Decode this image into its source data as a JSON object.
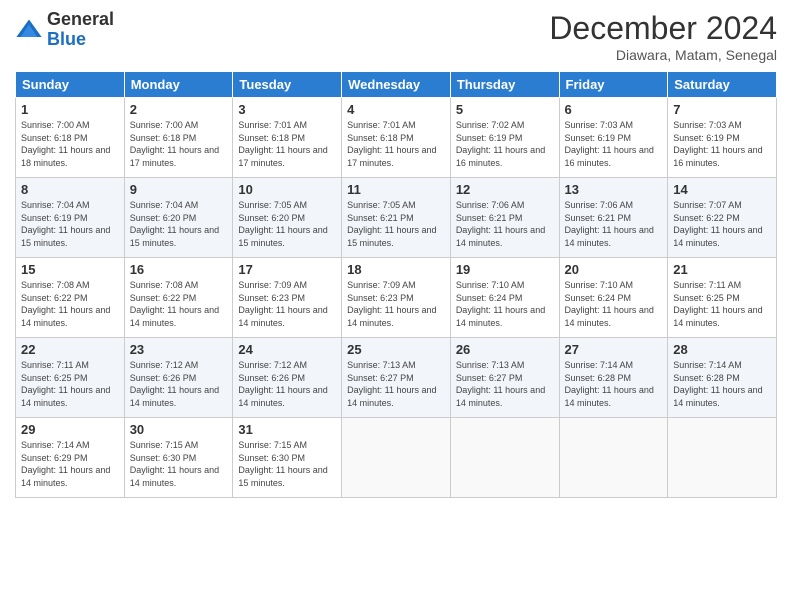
{
  "logo": {
    "general": "General",
    "blue": "Blue"
  },
  "title": "December 2024",
  "subtitle": "Diawara, Matam, Senegal",
  "days_of_week": [
    "Sunday",
    "Monday",
    "Tuesday",
    "Wednesday",
    "Thursday",
    "Friday",
    "Saturday"
  ],
  "weeks": [
    [
      {
        "day": "1",
        "sunrise": "7:00 AM",
        "sunset": "6:18 PM",
        "daylight": "11 hours and 18 minutes."
      },
      {
        "day": "2",
        "sunrise": "7:00 AM",
        "sunset": "6:18 PM",
        "daylight": "11 hours and 17 minutes."
      },
      {
        "day": "3",
        "sunrise": "7:01 AM",
        "sunset": "6:18 PM",
        "daylight": "11 hours and 17 minutes."
      },
      {
        "day": "4",
        "sunrise": "7:01 AM",
        "sunset": "6:18 PM",
        "daylight": "11 hours and 17 minutes."
      },
      {
        "day": "5",
        "sunrise": "7:02 AM",
        "sunset": "6:19 PM",
        "daylight": "11 hours and 16 minutes."
      },
      {
        "day": "6",
        "sunrise": "7:03 AM",
        "sunset": "6:19 PM",
        "daylight": "11 hours and 16 minutes."
      },
      {
        "day": "7",
        "sunrise": "7:03 AM",
        "sunset": "6:19 PM",
        "daylight": "11 hours and 16 minutes."
      }
    ],
    [
      {
        "day": "8",
        "sunrise": "7:04 AM",
        "sunset": "6:19 PM",
        "daylight": "11 hours and 15 minutes."
      },
      {
        "day": "9",
        "sunrise": "7:04 AM",
        "sunset": "6:20 PM",
        "daylight": "11 hours and 15 minutes."
      },
      {
        "day": "10",
        "sunrise": "7:05 AM",
        "sunset": "6:20 PM",
        "daylight": "11 hours and 15 minutes."
      },
      {
        "day": "11",
        "sunrise": "7:05 AM",
        "sunset": "6:21 PM",
        "daylight": "11 hours and 15 minutes."
      },
      {
        "day": "12",
        "sunrise": "7:06 AM",
        "sunset": "6:21 PM",
        "daylight": "11 hours and 14 minutes."
      },
      {
        "day": "13",
        "sunrise": "7:06 AM",
        "sunset": "6:21 PM",
        "daylight": "11 hours and 14 minutes."
      },
      {
        "day": "14",
        "sunrise": "7:07 AM",
        "sunset": "6:22 PM",
        "daylight": "11 hours and 14 minutes."
      }
    ],
    [
      {
        "day": "15",
        "sunrise": "7:08 AM",
        "sunset": "6:22 PM",
        "daylight": "11 hours and 14 minutes."
      },
      {
        "day": "16",
        "sunrise": "7:08 AM",
        "sunset": "6:22 PM",
        "daylight": "11 hours and 14 minutes."
      },
      {
        "day": "17",
        "sunrise": "7:09 AM",
        "sunset": "6:23 PM",
        "daylight": "11 hours and 14 minutes."
      },
      {
        "day": "18",
        "sunrise": "7:09 AM",
        "sunset": "6:23 PM",
        "daylight": "11 hours and 14 minutes."
      },
      {
        "day": "19",
        "sunrise": "7:10 AM",
        "sunset": "6:24 PM",
        "daylight": "11 hours and 14 minutes."
      },
      {
        "day": "20",
        "sunrise": "7:10 AM",
        "sunset": "6:24 PM",
        "daylight": "11 hours and 14 minutes."
      },
      {
        "day": "21",
        "sunrise": "7:11 AM",
        "sunset": "6:25 PM",
        "daylight": "11 hours and 14 minutes."
      }
    ],
    [
      {
        "day": "22",
        "sunrise": "7:11 AM",
        "sunset": "6:25 PM",
        "daylight": "11 hours and 14 minutes."
      },
      {
        "day": "23",
        "sunrise": "7:12 AM",
        "sunset": "6:26 PM",
        "daylight": "11 hours and 14 minutes."
      },
      {
        "day": "24",
        "sunrise": "7:12 AM",
        "sunset": "6:26 PM",
        "daylight": "11 hours and 14 minutes."
      },
      {
        "day": "25",
        "sunrise": "7:13 AM",
        "sunset": "6:27 PM",
        "daylight": "11 hours and 14 minutes."
      },
      {
        "day": "26",
        "sunrise": "7:13 AM",
        "sunset": "6:27 PM",
        "daylight": "11 hours and 14 minutes."
      },
      {
        "day": "27",
        "sunrise": "7:14 AM",
        "sunset": "6:28 PM",
        "daylight": "11 hours and 14 minutes."
      },
      {
        "day": "28",
        "sunrise": "7:14 AM",
        "sunset": "6:28 PM",
        "daylight": "11 hours and 14 minutes."
      }
    ],
    [
      {
        "day": "29",
        "sunrise": "7:14 AM",
        "sunset": "6:29 PM",
        "daylight": "11 hours and 14 minutes."
      },
      {
        "day": "30",
        "sunrise": "7:15 AM",
        "sunset": "6:30 PM",
        "daylight": "11 hours and 14 minutes."
      },
      {
        "day": "31",
        "sunrise": "7:15 AM",
        "sunset": "6:30 PM",
        "daylight": "11 hours and 15 minutes."
      },
      null,
      null,
      null,
      null
    ]
  ],
  "labels": {
    "sunrise": "Sunrise:",
    "sunset": "Sunset:",
    "daylight": "Daylight:"
  }
}
